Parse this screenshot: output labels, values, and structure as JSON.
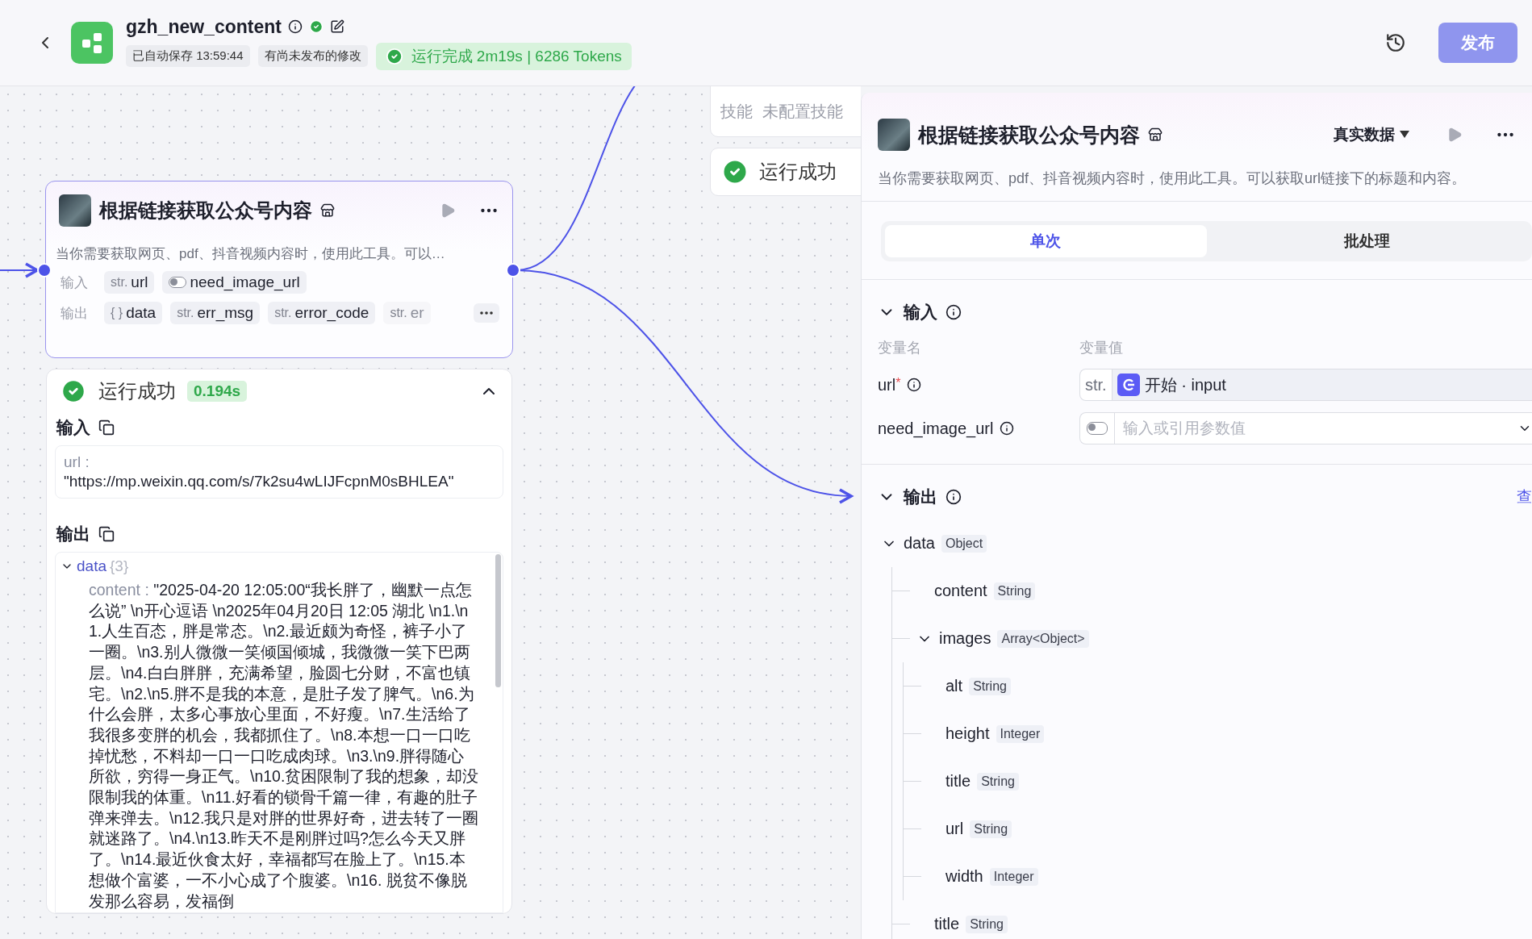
{
  "header": {
    "title": "gzh_new_content",
    "autosave": "已自动保存 13:59:44",
    "unpublished": "有尚未发布的修改",
    "run_status": "运行完成 2m19s | 6286 Tokens",
    "publish": {
      "label": "发布",
      "disabled": true
    }
  },
  "node": {
    "title": "根据链接获取公众号内容",
    "description": "当你需要获取网页、pdf、抖音视频内容时，使用此工具。可以…",
    "inputs_label": "输入",
    "outputs_label": "输出",
    "inputs": [
      {
        "kind": "typed",
        "type": "str.",
        "name": "url"
      },
      {
        "kind": "toggle",
        "name": "need_image_url",
        "on": false
      }
    ],
    "outputs": [
      {
        "type": "{ }",
        "name": "data",
        "faded": false
      },
      {
        "type": "str.",
        "name": "err_msg",
        "faded": false
      },
      {
        "type": "str.",
        "name": "error_code",
        "faded": false
      },
      {
        "type": "str.",
        "name": "er",
        "faded": true
      }
    ]
  },
  "result": {
    "status": "运行成功",
    "duration": "0.194s",
    "expanded": true,
    "input_label": "输入",
    "input_key": "url :",
    "input_value": "\"https://mp.weixin.qq.com/s/7k2su4wLIJFcpnM0sBHLEA\"",
    "output_label": "输出",
    "tree_key": "data",
    "tree_count": "{3}",
    "tree_expanded": true,
    "content_key": "content :",
    "content_value": "\"2025-04-20 12:05:00“我长胖了，幽默一点怎么说” \\n开心逗语 \\n2025年04月20日 12:05 湖北 \\n1.\\n1.人生百态，胖是常态。\\n2.最近颇为奇怪，裤子小了一圈。\\n3.别人微微一笑倾国倾城，我微微一笑下巴两层。\\n4.白白胖胖，充满希望，脸圆七分财，不富也镇宅。\\n2.\\n5.胖不是我的本意，是肚子发了脾气。\\n6.为什么会胖，太多心事放心里面，不好瘦。\\n7.生活给了我很多变胖的机会，我都抓住了。\\n8.本想一口一口吃掉忧愁，不料却一口一口吃成肉球。\\n3.\\n9.胖得随心所欲，穷得一身正气。\\n10.贫困限制了我的想象，却没限制我的体重。\\n11.好看的锁骨千篇一律，有趣的肚子弹来弹去。\\n12.我只是对胖的世界好奇，进去转了一圈就迷路了。\\n4.\\n13.昨天不是刚胖过吗?怎么今天又胖了。\\n14.最近伙食太好，幸福都写在脸上了。\\n15.本想做个富婆，一不小心成了个腹婆。\\n16. 脱贫不像脱发那么容易，发福倒"
  },
  "side_card": {
    "skills_label": "技能",
    "skills_value": "未配置技能",
    "status": "运行成功"
  },
  "panel": {
    "title": "根据链接获取公众号内容",
    "mode": "真实数据",
    "description": "当你需要获取网页、pdf、抖音视频内容时，使用此工具。可以获取url链接下的标题和内容。",
    "tabs": [
      {
        "label": "单次",
        "selected": true
      },
      {
        "label": "批处理",
        "selected": false
      }
    ],
    "input": {
      "title": "输入",
      "expanded": true,
      "name_header": "变量名",
      "value_header": "变量值",
      "params": [
        {
          "kind": "reference",
          "name": "url",
          "required_mark": "*",
          "type": "str.",
          "value": "开始 · input"
        },
        {
          "kind": "toggle",
          "name": "need_image_url",
          "on": false,
          "placeholder": "输入或引用参数值"
        }
      ]
    },
    "output": {
      "title": "输出",
      "link": "查",
      "tree": [
        {
          "name": "data",
          "type": "Object",
          "expanded": true,
          "children": [
            {
              "name": "content",
              "type": "String"
            },
            {
              "name": "images",
              "type": "Array<Object>",
              "expanded": true,
              "children": [
                {
                  "name": "alt",
                  "type": "String"
                },
                {
                  "name": "height",
                  "type": "Integer"
                },
                {
                  "name": "title",
                  "type": "String"
                },
                {
                  "name": "url",
                  "type": "String"
                },
                {
                  "name": "width",
                  "type": "Integer"
                }
              ]
            },
            {
              "name": "title",
              "type": "String"
            }
          ]
        }
      ]
    }
  }
}
